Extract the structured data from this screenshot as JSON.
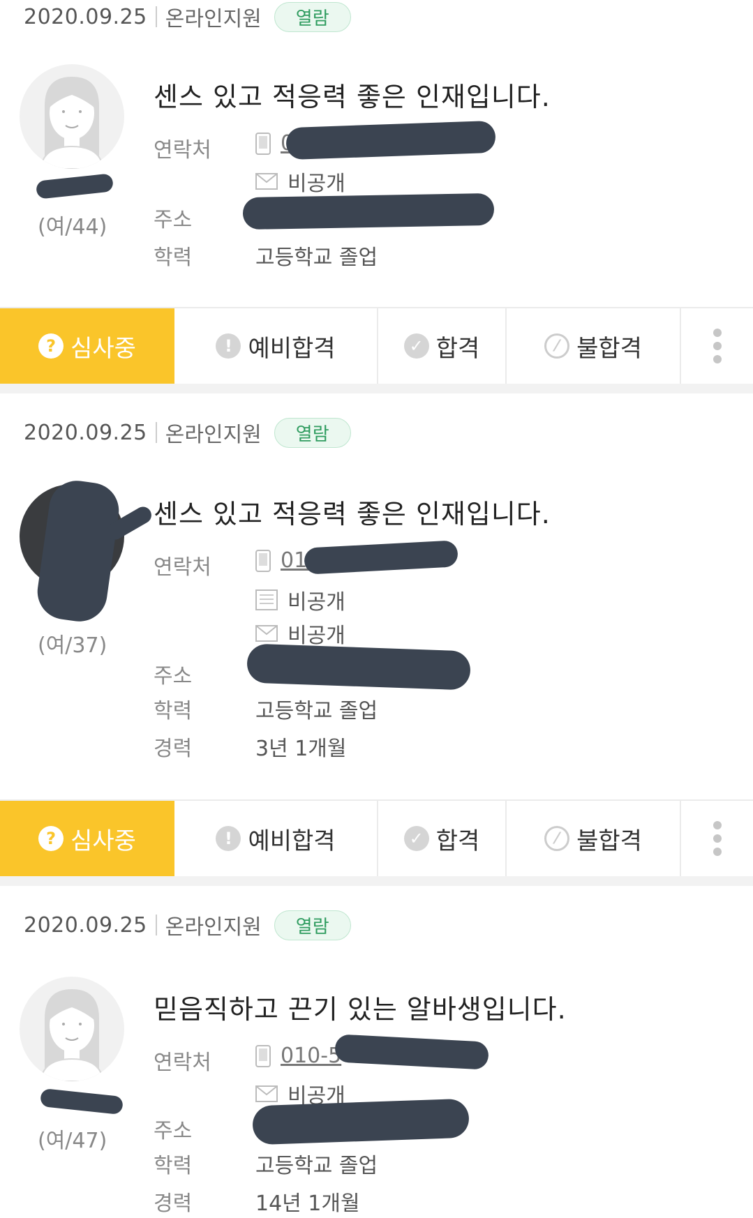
{
  "cards": [
    {
      "date": "2020.09.25",
      "source": "온라인지원",
      "badge": "열람",
      "age": "(여/44)",
      "headline": "센스 있고 적응력 좋은 인재입니다.",
      "contact_label": "연락처",
      "phone": "010-66",
      "email": "비공개",
      "address_label": "주소",
      "edu_label": "학력",
      "edu": "고등학교 졸업"
    },
    {
      "date": "2020.09.25",
      "source": "온라인지원",
      "badge": "열람",
      "age": "(여/37)",
      "headline": "센스 있고 적응력 좋은 인재입니다.",
      "contact_label": "연락처",
      "phone": "010-9",
      "fax": "비공개",
      "email": "비공개",
      "address_label": "주소",
      "edu_label": "학력",
      "edu": "고등학교 졸업",
      "career_label": "경력",
      "career": "3년 1개월"
    },
    {
      "date": "2020.09.25",
      "source": "온라인지원",
      "badge": "열람",
      "age": "(여/47)",
      "headline": "믿음직하고 끈기 있는 알바생입니다.",
      "contact_label": "연락처",
      "phone": "010-5",
      "email": "비공개",
      "address_label": "주소",
      "edu_label": "학력",
      "edu": "고등학교 졸업",
      "career_label": "경력",
      "career": "14년 1개월"
    }
  ],
  "actions": {
    "reviewing": "심사중",
    "preliminary": "예비합격",
    "pass": "합격",
    "fail": "불합격"
  },
  "colors": {
    "active_yellow": "#fac52a",
    "badge_green": "#2f9c5f",
    "redaction": "#3b4451"
  },
  "icons": [
    "question-icon",
    "exclamation-icon",
    "check-icon",
    "ban-icon",
    "more-vertical-icon",
    "phone-icon",
    "mail-icon",
    "fax-icon"
  ]
}
